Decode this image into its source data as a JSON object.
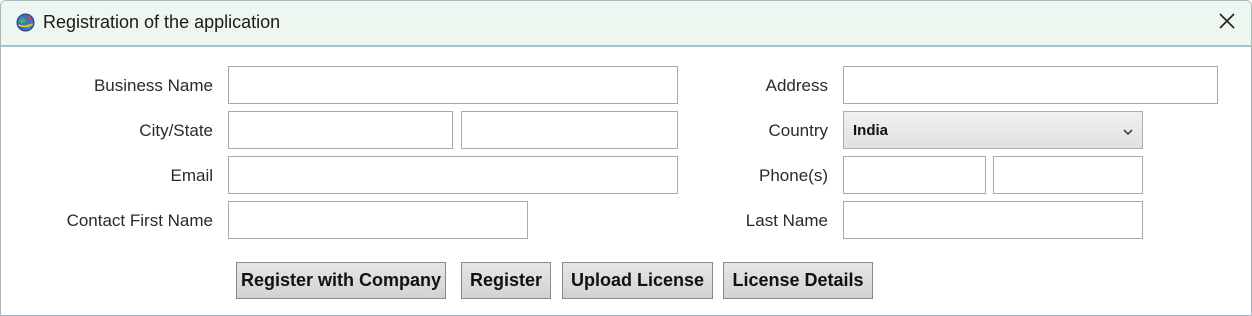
{
  "window": {
    "title": "Registration of the application"
  },
  "form": {
    "business_name_label": "Business Name",
    "business_name_value": "",
    "city_state_label": "City/State",
    "city_value": "",
    "state_value": "",
    "email_label": "Email",
    "email_value": "",
    "contact_first_name_label": "Contact First Name",
    "contact_first_name_value": "",
    "address_label": "Address",
    "address_value": "",
    "country_label": "Country",
    "country_selected": "India",
    "phones_label": "Phone(s)",
    "phone1_value": "",
    "phone2_value": "",
    "last_name_label": "Last Name",
    "last_name_value": ""
  },
  "buttons": {
    "register_with_company": "Register with Company",
    "register": "Register",
    "upload_license": "Upload License",
    "license_details": "License Details"
  },
  "icons": {
    "app": "app-globe-icon",
    "close": "close-icon"
  }
}
